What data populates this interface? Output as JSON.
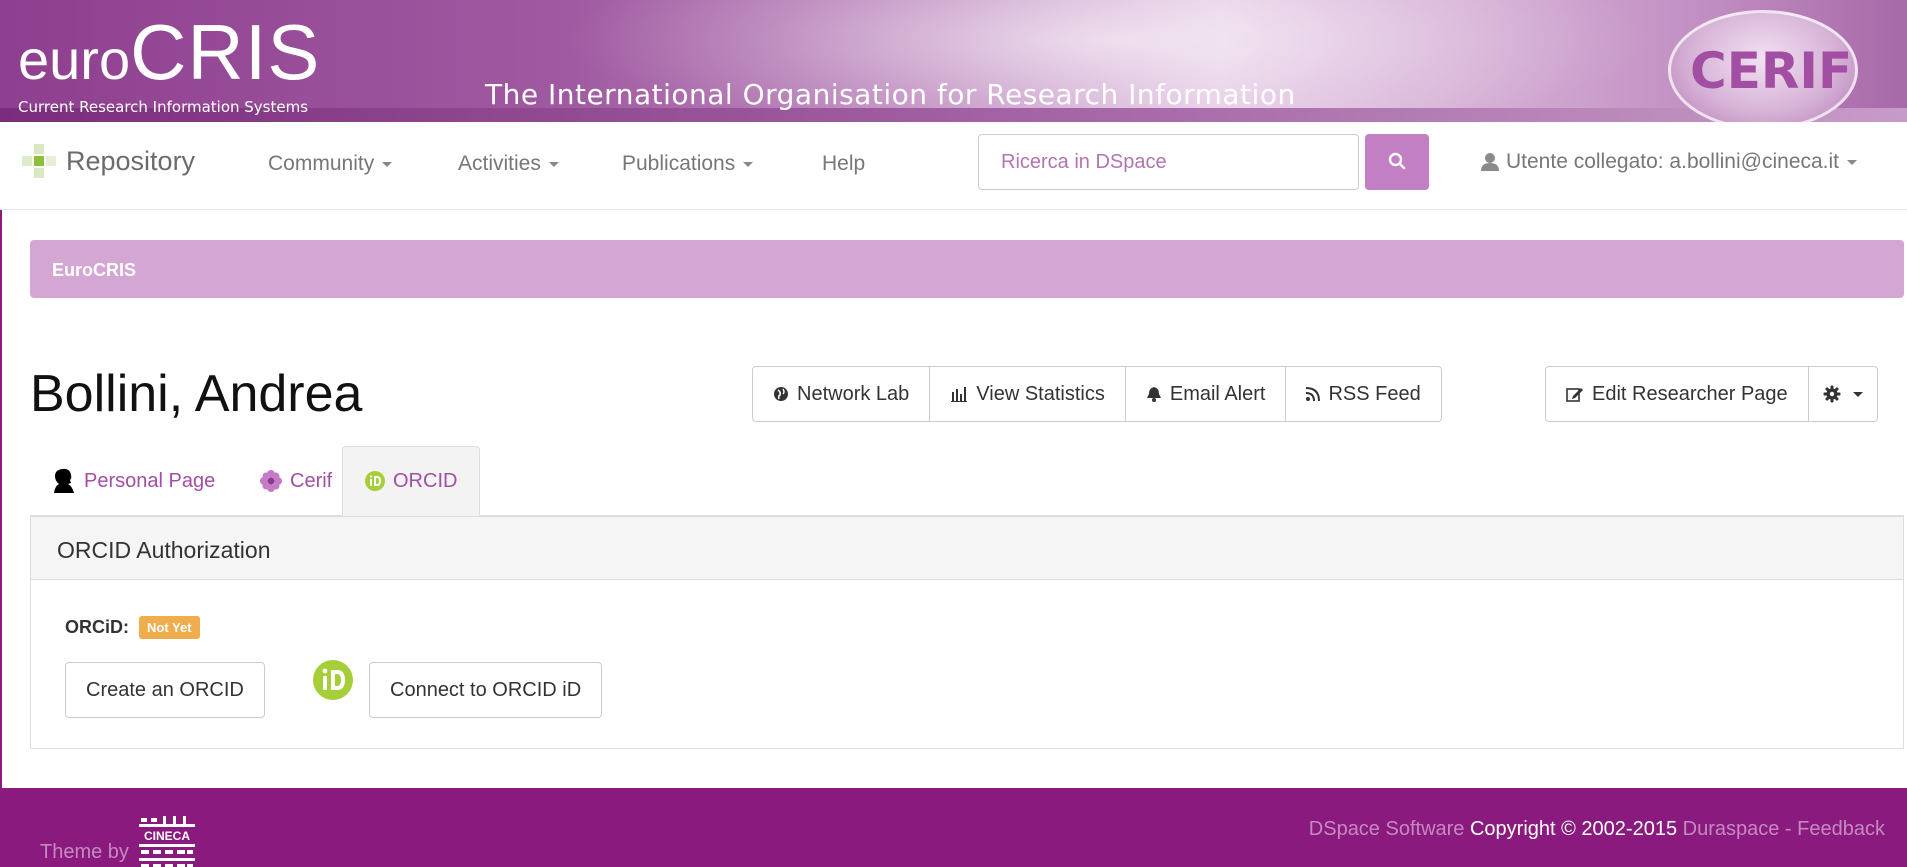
{
  "banner": {
    "logo_prefix": "euro",
    "logo_main": "CRIS",
    "logo_subtitle": "Current Research Information Systems",
    "title": "The International Organisation for Research Information",
    "badge": "CERIF",
    "brand_color": "#8e3f8f"
  },
  "navbar": {
    "brand": "Repository",
    "items": [
      {
        "label": "Community",
        "dropdown": true
      },
      {
        "label": "Activities",
        "dropdown": true
      },
      {
        "label": "Publications",
        "dropdown": true
      },
      {
        "label": "Help",
        "dropdown": false
      }
    ],
    "search_placeholder": "Ricerca in DSpace",
    "user_label": "Utente collegato: a.bollini@cineca.it"
  },
  "breadcrumb": {
    "label": "EuroCRIS",
    "color": "#d3a6d3"
  },
  "page": {
    "title": "Bollini, Andrea",
    "actions": {
      "network_lab": "Network Lab",
      "view_statistics": "View Statistics",
      "email_alert": "Email Alert",
      "rss_feed": "RSS Feed",
      "edit_researcher_page": "Edit Researcher Page"
    }
  },
  "tabs": [
    {
      "label": "Personal Page",
      "icon": "person-silhouette-icon",
      "active": false
    },
    {
      "label": "Cerif",
      "icon": "flower-icon",
      "active": false
    },
    {
      "label": "ORCID",
      "icon": "orcid-icon",
      "active": true
    }
  ],
  "panel": {
    "heading": "ORCID Authorization",
    "orcid_label": "ORCiD:",
    "status_badge": "Not Yet",
    "create_button": "Create an ORCID",
    "connect_button": "Connect to ORCID iD"
  },
  "footer": {
    "theme_by": "Theme by",
    "cineca_label": "CINECA",
    "dspace": "DSpace Software",
    "copyright": "Copyright © 2002-2015",
    "duraspace": "Duraspace",
    "separator": "-",
    "feedback": "Feedback"
  }
}
